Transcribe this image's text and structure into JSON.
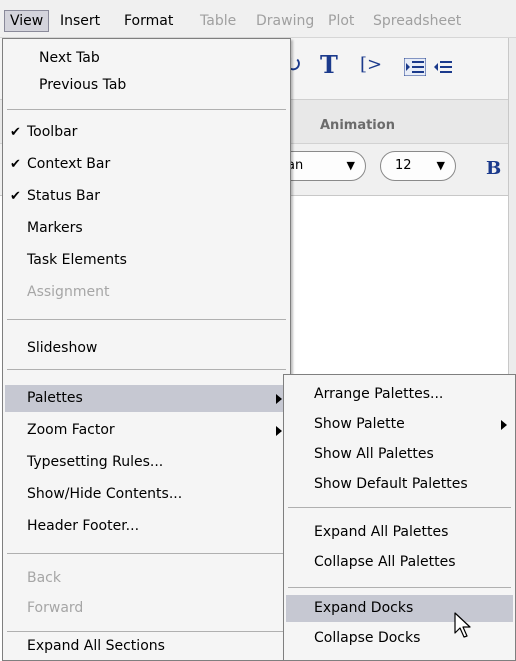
{
  "menubar": {
    "items": [
      {
        "label": "View",
        "state": "active"
      },
      {
        "label": "Insert",
        "state": "normal"
      },
      {
        "label": "Format",
        "state": "normal"
      },
      {
        "label": "Table",
        "state": "disabled"
      },
      {
        "label": "Drawing",
        "state": "disabled"
      },
      {
        "label": "Plot",
        "state": "disabled"
      },
      {
        "label": "Spreadsheet",
        "state": "disabled"
      }
    ]
  },
  "toolbar": {
    "redo_glyph": "↻",
    "text_glyph": "T",
    "math_glyph": "[>"
  },
  "context_bar": {
    "title": "Animation",
    "font_value": "an",
    "size_value": "12",
    "bold_label": "B"
  },
  "view_menu": {
    "items": [
      {
        "label": "Next Tab"
      },
      {
        "label": "Previous Tab"
      },
      {
        "label": "Toolbar",
        "checked": true
      },
      {
        "label": "Context Bar",
        "checked": true
      },
      {
        "label": "Status Bar",
        "checked": true
      },
      {
        "label": "Markers"
      },
      {
        "label": "Task Elements"
      },
      {
        "label": "Assignment",
        "disabled": true
      },
      {
        "label": "Slideshow"
      },
      {
        "label": "Palettes",
        "submenu": true,
        "highlighted": true
      },
      {
        "label": "Zoom Factor",
        "submenu": true
      },
      {
        "label": "Typesetting Rules..."
      },
      {
        "label": "Show/Hide Contents..."
      },
      {
        "label": "Header Footer..."
      },
      {
        "label": "Back",
        "disabled": true
      },
      {
        "label": "Forward",
        "disabled": true
      },
      {
        "label": "Expand All Sections"
      }
    ],
    "check_glyph": "✔"
  },
  "palettes_menu": {
    "items": [
      {
        "label": "Arrange Palettes..."
      },
      {
        "label": "Show Palette",
        "submenu": true
      },
      {
        "label": "Show All Palettes"
      },
      {
        "label": "Show Default Palettes"
      },
      {
        "label": "Expand All Palettes"
      },
      {
        "label": "Collapse All Palettes"
      },
      {
        "label": "Expand Docks",
        "highlighted": true
      },
      {
        "label": "Collapse Docks"
      }
    ]
  },
  "colors": {
    "menu_highlight": "#c6c8d2",
    "toolbar_icon": "#1b3a8c",
    "disabled_text": "#a6a6a6"
  }
}
